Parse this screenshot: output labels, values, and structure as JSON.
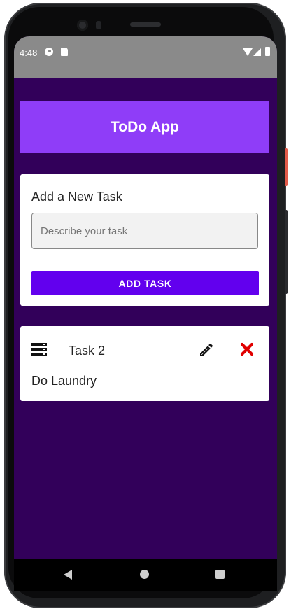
{
  "status_bar": {
    "time": "4:48"
  },
  "header": {
    "title": "ToDo App"
  },
  "add_task": {
    "title": "Add a New Task",
    "input_placeholder": "Describe your task",
    "input_value": "",
    "button_label": "ADD TASK"
  },
  "tasks": [
    {
      "title": "Task 2",
      "description": "Do Laundry"
    }
  ],
  "colors": {
    "background": "#32005a",
    "header": "#8f3df8",
    "primary_button": "#6200ee",
    "delete": "#e00000",
    "status_bar": "#8a8a8a"
  },
  "icons": {
    "task_icon": "list-icon",
    "edit_icon": "pencil-icon",
    "delete_icon": "close-icon",
    "nav": [
      "back-icon",
      "home-icon",
      "recents-icon"
    ]
  }
}
